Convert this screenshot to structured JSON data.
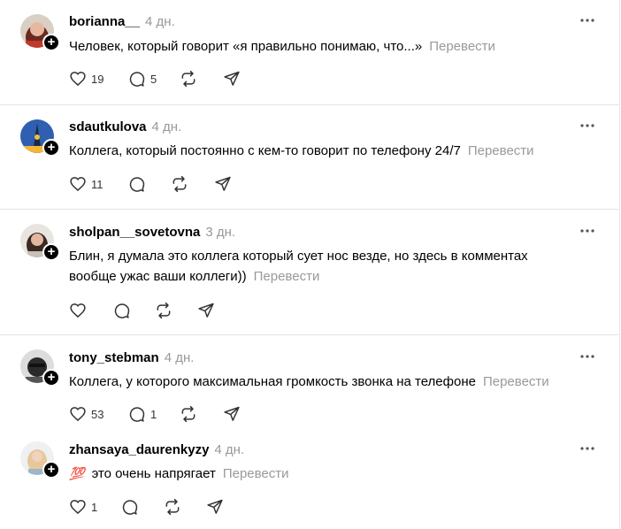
{
  "posts": [
    {
      "username": "borianna__",
      "time": "4 дн.",
      "text": "Человек, который говорит «я правильно понимаю, что...»",
      "translate": "Перевести",
      "likes": "19",
      "replies": "5"
    },
    {
      "username": "sdautkulova",
      "time": "4 дн.",
      "text": "Коллега, который постоянно с кем-то говорит по телефону 24/7",
      "translate": "Перевести",
      "likes": "11",
      "replies": ""
    },
    {
      "username": "sholpan__sovetovna",
      "time": "3 дн.",
      "text_line1": "Блин, я думала это коллега который сует нос везде, но здесь в комментах",
      "text_line2": "вообще ужас ваши коллеги))",
      "translate": "Перевести",
      "likes": "",
      "replies": ""
    },
    {
      "username": "tony_stebman",
      "time": "4 дн.",
      "text": "Коллега, у которого максимальная громкость звонка на телефоне",
      "translate": "Перевести",
      "likes": "53",
      "replies": "1"
    },
    {
      "username": "zhansaya_daurenkyzy",
      "time": "4 дн.",
      "emoji": "💯",
      "text": "это очень напрягает",
      "translate": "Перевести",
      "likes": "1",
      "replies": ""
    }
  ],
  "colors": {
    "muted": "#999999",
    "divider": "#e3e3e3",
    "badge": "#000000"
  },
  "icons": [
    "heart-icon",
    "reply-icon",
    "repost-icon",
    "share-icon",
    "more-icon",
    "plus-icon"
  ]
}
